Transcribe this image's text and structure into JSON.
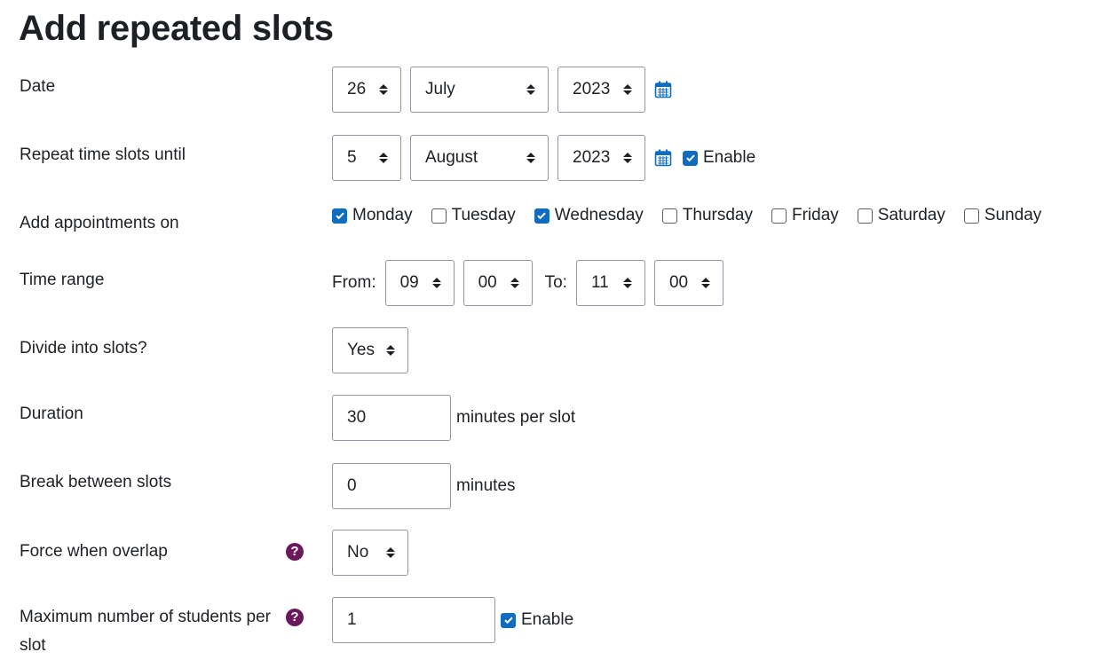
{
  "title": "Add repeated slots",
  "date": {
    "label": "Date",
    "day": "26",
    "month": "July",
    "year": "2023"
  },
  "repeat_until": {
    "label": "Repeat time slots until",
    "day": "5",
    "month": "August",
    "year": "2023",
    "enable_label": "Enable",
    "enable_checked": true
  },
  "appointments": {
    "label": "Add appointments on",
    "days": [
      {
        "label": "Monday",
        "checked": true
      },
      {
        "label": "Tuesday",
        "checked": false
      },
      {
        "label": "Wednesday",
        "checked": true
      },
      {
        "label": "Thursday",
        "checked": false
      },
      {
        "label": "Friday",
        "checked": false
      },
      {
        "label": "Saturday",
        "checked": false
      },
      {
        "label": "Sunday",
        "checked": false
      }
    ]
  },
  "time_range": {
    "label": "Time range",
    "from_label": "From:",
    "from_hour": "09",
    "from_minute": "00",
    "to_label": "To:",
    "to_hour": "11",
    "to_minute": "00"
  },
  "divide": {
    "label": "Divide into slots?",
    "value": "Yes"
  },
  "duration": {
    "label": "Duration",
    "value": "30",
    "suffix": "minutes per slot"
  },
  "break": {
    "label": "Break between slots",
    "value": "0",
    "suffix": "minutes"
  },
  "force": {
    "label": "Force when overlap",
    "value": "No"
  },
  "max_students": {
    "label": "Maximum number of students per slot",
    "value": "1",
    "enable_label": "Enable",
    "enable_checked": true
  },
  "colors": {
    "checkbox_accent": "#0f6cbf",
    "help_icon": "#6a1a5c",
    "calendar_icon": "#0f6cbf"
  },
  "icons": [
    "calendar-icon",
    "help-icon",
    "checkmark-icon",
    "select-caret-icon"
  ]
}
